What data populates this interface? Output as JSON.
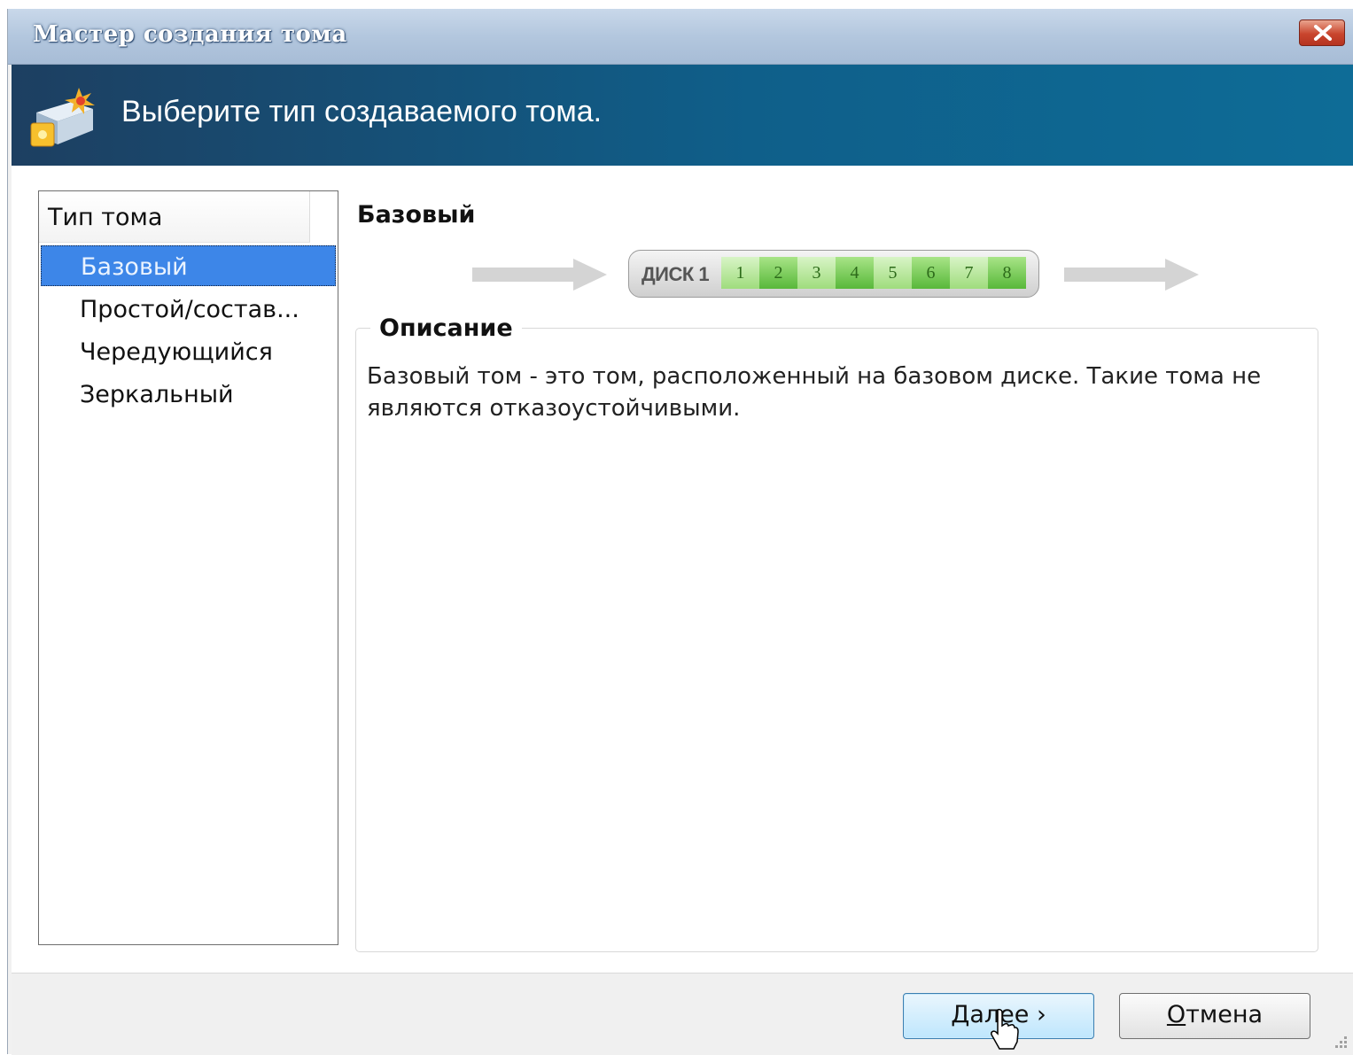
{
  "window": {
    "title": "Мастер создания тома",
    "header_text": "Выберите тип создаваемого тома."
  },
  "type_list": {
    "header": "Тип тома",
    "items": [
      {
        "label": "Базовый",
        "selected": true
      },
      {
        "label": "Простой/состав...",
        "selected": false
      },
      {
        "label": "Чередующийся",
        "selected": false
      },
      {
        "label": "Зеркальный",
        "selected": false
      }
    ]
  },
  "detail": {
    "type_title": "Базовый",
    "disk_label": "ДИСК 1",
    "segments": [
      "1",
      "2",
      "3",
      "4",
      "5",
      "6",
      "7",
      "8"
    ],
    "description_caption": "Описание",
    "description_text": "Базовый том - это том, расположенный на базовом диске. Такие тома не являются отказоустойчивыми."
  },
  "buttons": {
    "next_access_key": "Д",
    "next_rest": "алее ›",
    "cancel_access_key": "О",
    "cancel_rest": "тмена"
  },
  "icons": {
    "close": "close-icon",
    "wizard": "volume-wizard-icon",
    "cursor": "hand-cursor-icon",
    "arrow_left": "arrow-right-icon",
    "arrow_right": "arrow-right-icon",
    "grip": "resize-grip-icon"
  },
  "colors": {
    "selection": "#3d86e8",
    "header_band": "#0f5f8a",
    "segment_green": "#58b83a"
  }
}
